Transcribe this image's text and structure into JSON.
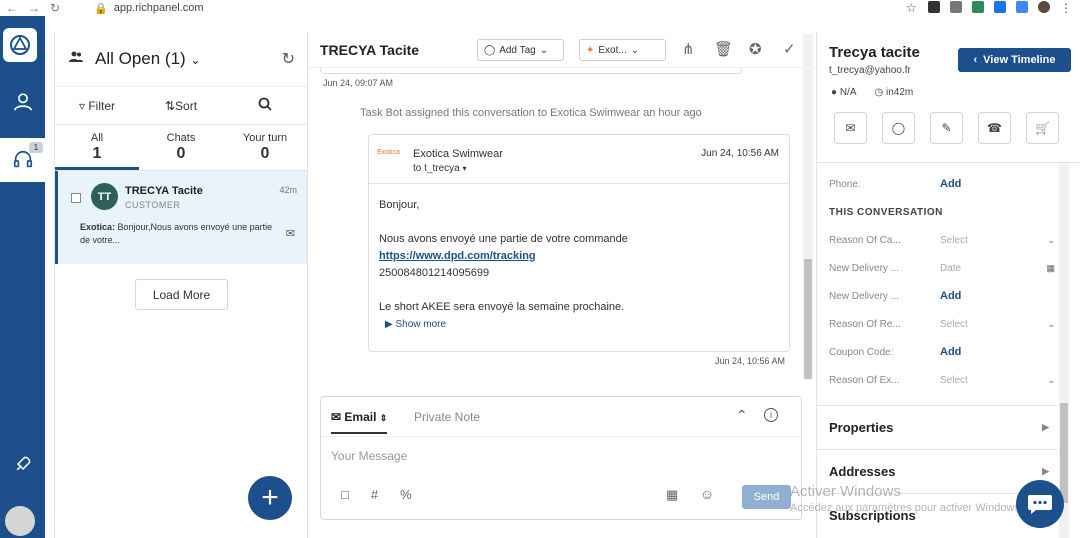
{
  "browser": {
    "url": "app.richpanel.com"
  },
  "nav": {
    "badge": "1"
  },
  "list": {
    "title": "All Open (1)",
    "filter_label": "Filter",
    "sort_label": "Sort",
    "tabs": [
      {
        "label": "All",
        "count": "1"
      },
      {
        "label": "Chats",
        "count": "0"
      },
      {
        "label": "Your turn",
        "count": "0"
      }
    ],
    "conversation": {
      "initials": "TT",
      "name": "TRECYA Tacite",
      "role": "CUSTOMER",
      "time": "42m",
      "snippet_from": "Exotica:",
      "snippet": "Bonjour,Nous avons envoyé une partie de votre..."
    },
    "load_more": "Load More"
  },
  "conversation": {
    "title": "TRECYA Tacite",
    "add_tag": "Add Tag",
    "brand_select": "Exot...",
    "date_top": "Jun 24, 09:07 AM",
    "bot_note": "Task Bot assigned this conversation to Exotica Swimwear an hour ago",
    "message": {
      "logo_text": "Exotica",
      "from": "Exotica Swimwear",
      "to": "to t_trecya",
      "time": "Jun 24, 10:56 AM",
      "greeting": "Bonjour,",
      "line1": "Nous avons envoyé une partie de votre commande",
      "link": "https://www.dpd.com/tracking",
      "tracking": "250084801214095699",
      "line2": "Le short AKEE sera envoyé la semaine prochaine.",
      "show_more": "Show more"
    },
    "date_bottom": "Jun 24, 10:56 AM"
  },
  "composer": {
    "email_tab": "Email",
    "private_tab": "Private Note",
    "placeholder": "Your Message",
    "send": "Send"
  },
  "customer": {
    "name": "Trecya tacite",
    "email": "t_trecya@yahoo.fr",
    "view_timeline": "View Timeline",
    "location": "N/A",
    "local_time": "in42m",
    "phone_label": "Phone:",
    "phone_value": "Add",
    "section": "THIS CONVERSATION",
    "fields": [
      {
        "label": "Reason Of Ca...",
        "value": "Select"
      },
      {
        "label": "New Delivery ...",
        "value": "Date"
      },
      {
        "label": "New Delivery ...",
        "value": "Add"
      },
      {
        "label": "Reason Of Re...",
        "value": "Select"
      },
      {
        "label": "Coupon Code:",
        "value": "Add"
      },
      {
        "label": "Reason Of Ex...",
        "value": "Select"
      }
    ],
    "panels": [
      "Properties",
      "Addresses",
      "Subscriptions"
    ]
  },
  "watermark": {
    "line1": "Activer Windows",
    "line2": "Accédez aux paramètres pour activer Windows."
  },
  "colors": {
    "brand": "#1d4f8c",
    "accent_light": "#e8f3fb"
  }
}
